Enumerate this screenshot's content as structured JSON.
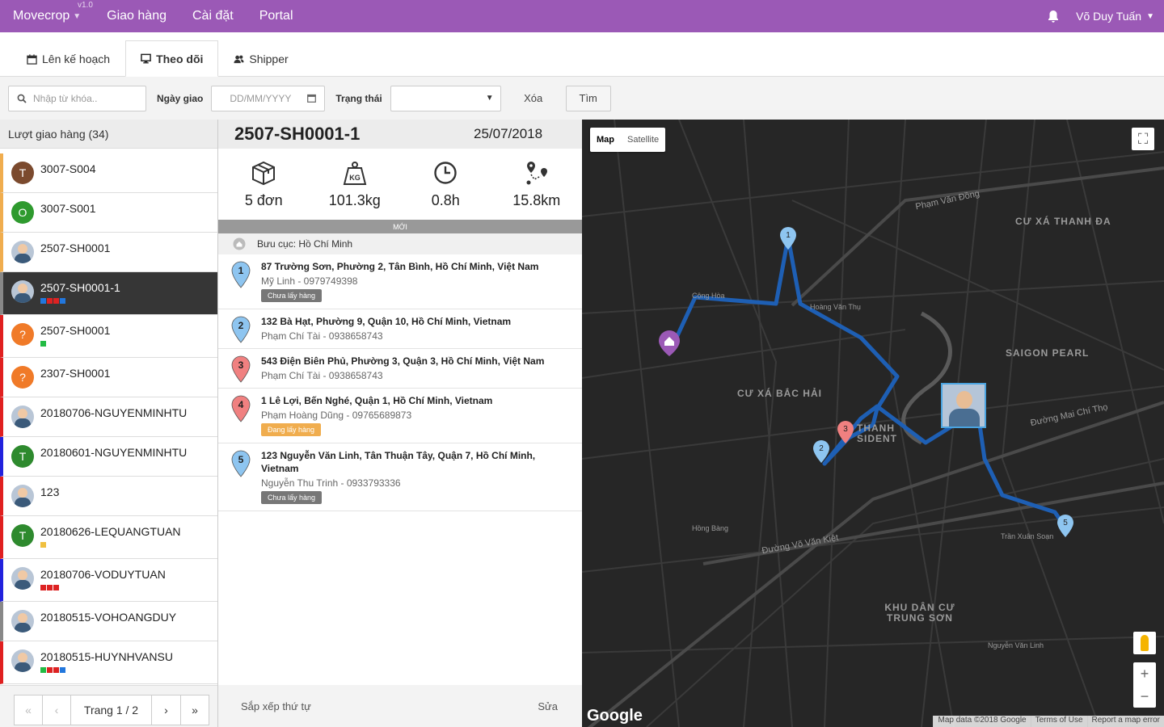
{
  "topnav": {
    "brand": "Movecrop",
    "version": "v1.0",
    "links": [
      "Giao hàng",
      "Cài đặt",
      "Portal"
    ],
    "user": "Võ Duy Tuấn"
  },
  "tabs": [
    {
      "label": "Lên kế hoạch",
      "icon": "calendar-icon"
    },
    {
      "label": "Theo dõi",
      "icon": "monitor-icon",
      "active": true
    },
    {
      "label": "Shipper",
      "icon": "users-icon"
    }
  ],
  "filters": {
    "search_placeholder": "Nhập từ khóa..",
    "date_label": "Ngày giao",
    "date_placeholder": "DD/MM/YYYY",
    "status_label": "Trạng thái",
    "status_value": "",
    "clear_label": "Xóa",
    "find_label": "Tìm"
  },
  "list": {
    "title": "Lượt giao hàng (34)",
    "items": [
      {
        "name": "3007-S004",
        "avatar": "T",
        "avatar_color": "#7b4a2e",
        "border": "#f0ad4e",
        "chips": []
      },
      {
        "name": "3007-S001",
        "avatar": "O",
        "avatar_color": "#2e9a2e",
        "border": "#f0ad4e",
        "chips": []
      },
      {
        "name": "2507-SH0001",
        "avatar": "photo",
        "border": "#f0ad4e",
        "chips": []
      },
      {
        "name": "2507-SH0001-1",
        "avatar": "photo",
        "border": "#888888",
        "selected": true,
        "chips": [
          "#2277dd",
          "#dd2222",
          "#dd2222",
          "#2277dd"
        ]
      },
      {
        "name": "2507-SH0001",
        "avatar": "?",
        "avatar_color": "#f07a28",
        "border": "#e02020",
        "chips": [
          "#22bb44"
        ]
      },
      {
        "name": "2307-SH0001",
        "avatar": "?",
        "avatar_color": "#f07a28",
        "border": "#e02020",
        "chips": []
      },
      {
        "name": "20180706-NGUYENMINHTU",
        "avatar": "photo",
        "border": "#e02020",
        "chips": []
      },
      {
        "name": "20180601-NGUYENMINHTU",
        "avatar": "T",
        "avatar_color": "#2e8a2e",
        "border": "#2222dd",
        "chips": []
      },
      {
        "name": "123",
        "avatar": "photo",
        "border": "#e02020",
        "chips": []
      },
      {
        "name": "20180626-LEQUANGTUAN",
        "avatar": "T",
        "avatar_color": "#2e8a2e",
        "border": "#e02020",
        "chips": [
          "#f0c040"
        ]
      },
      {
        "name": "20180706-VODUYTUAN",
        "avatar": "photo",
        "border": "#2222dd",
        "chips": [
          "#dd2222",
          "#dd2222",
          "#dd2222"
        ]
      },
      {
        "name": "20180515-VOHOANGDUY",
        "avatar": "photo",
        "border": "#888888",
        "chips": []
      },
      {
        "name": "20180515-HUYNHVANSU",
        "avatar": "photo",
        "border": "#e02020",
        "chips": [
          "#22bb44",
          "#dd2222",
          "#dd2222",
          "#2277dd"
        ]
      }
    ],
    "pager": {
      "first": "«",
      "prev": "‹",
      "label": "Trang 1 / 2",
      "next": "›",
      "last": "»"
    }
  },
  "detail": {
    "code": "2507-SH0001-1",
    "date": "25/07/2018",
    "stats": [
      {
        "icon": "box-icon",
        "value": "5 đơn"
      },
      {
        "icon": "weight-icon",
        "value": "101.3kg"
      },
      {
        "icon": "clock-icon",
        "value": "0.8h"
      },
      {
        "icon": "route-icon",
        "value": "15.8km"
      }
    ],
    "status_bar": "MỚI",
    "depot": "Bưu cục: Hồ Chí Minh",
    "stops": [
      {
        "num": "1",
        "color": "#8ec5f0",
        "address": "87 Trường Sơn, Phường 2, Tân Bình, Hồ Chí Minh, Việt Nam",
        "contact": "Mỹ Linh - 0979749398",
        "badge": "Chưa lấy hàng",
        "badge_type": "gray"
      },
      {
        "num": "2",
        "color": "#8ec5f0",
        "address": "132 Bà Hạt, Phường 9, Quận 10, Hồ Chí Minh, Vietnam",
        "contact": "Phạm Chí Tài - 0938658743",
        "badge": "",
        "badge_type": ""
      },
      {
        "num": "3",
        "color": "#f08080",
        "address": "543 Điện Biên Phủ, Phường 3, Quận 3, Hồ Chí Minh, Việt Nam",
        "contact": "Phạm Chí Tài - 0938658743",
        "badge": "",
        "badge_type": ""
      },
      {
        "num": "4",
        "color": "#f08080",
        "address": "1 Lê Lợi, Bến Nghé, Quận 1, Hồ Chí Minh, Vietnam",
        "contact": "Phạm Hoàng Dũng - 09765689873",
        "badge": "Đang lấy hàng",
        "badge_type": "warn"
      },
      {
        "num": "5",
        "color": "#8ec5f0",
        "address": "123 Nguyễn Văn Linh, Tân Thuận Tây, Quận 7, Hồ Chí Minh, Vietnam",
        "contact": "Nguyễn Thu Trinh - 0933793336",
        "badge": "Chưa lấy hàng",
        "badge_type": "gray"
      }
    ],
    "footer": {
      "sort": "Sắp xếp thứ tự",
      "edit": "Sửa"
    }
  },
  "map": {
    "type_map": "Map",
    "type_satellite": "Satellite",
    "areas": [
      "CƯ XÁ THANH ĐA",
      "SAIGON PEARL",
      "CƯ XÁ BẮC HẢI",
      "THANH SIDENT",
      "KHU DÂN CƯ TRUNG SƠN"
    ],
    "streets": [
      "Phạm Văn Đồng",
      "Đường Mai Chí Thọ",
      "Đường Võ Văn Kiệt",
      "Nguyễn Văn Linh",
      "Trần Xuân Soạn",
      "Cộng Hòa",
      "Hoàng Văn Thụ",
      "Hồng Bàng"
    ],
    "markers": [
      "1",
      "2",
      "3",
      "5"
    ],
    "logo": "Google",
    "attribution": [
      "Map data ©2018 Google",
      "Terms of Use",
      "Report a map error"
    ],
    "route_color": "#1e5fb4",
    "zoom_in": "+",
    "zoom_out": "−"
  }
}
